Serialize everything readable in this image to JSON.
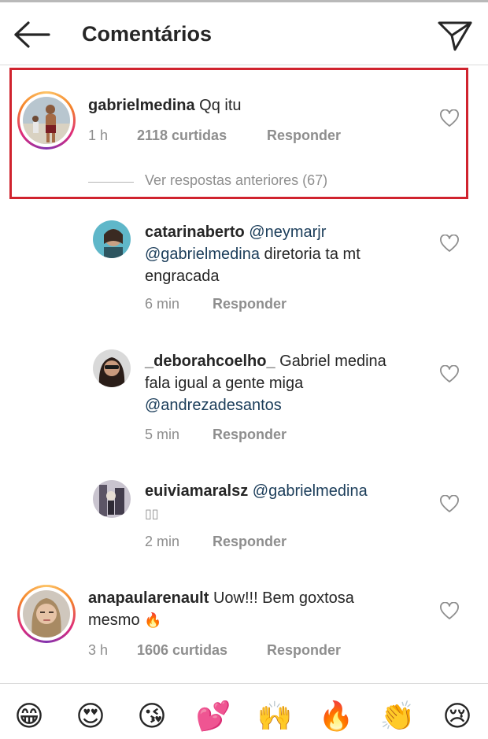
{
  "header": {
    "title": "Comentários",
    "back_icon": "arrow-left-icon",
    "send_icon": "paper-plane-icon"
  },
  "highlight_color": "#d0232e",
  "main_comment": {
    "username": "gabrielmedina",
    "text": "Qq itu",
    "time": "1 h",
    "likes": "2118 curtidas",
    "reply": "Responder",
    "view_previous": "Ver respostas anteriores (67)"
  },
  "replies": [
    {
      "username": "catarinaberto",
      "mention1": "@neymarjr",
      "mention2": "@gabrielmedina",
      "text_after": " diretoria ta mt",
      "line3": "engracada",
      "time": "6 min",
      "reply": "Responder"
    },
    {
      "username": "_deborahcoelho_",
      "text_line1": " Gabriel medina",
      "text_line2": "fala igual a gente miga",
      "mention": "@andrezadesantos",
      "time": "5 min",
      "reply": "Responder"
    },
    {
      "username": "euiviamaralsz",
      "mention": "@gabrielmedina",
      "text_line2": "▯▯",
      "time": "2 min",
      "reply": "Responder"
    }
  ],
  "second_comment": {
    "username": "anapaularenault",
    "text_line1": " Uow!!! Bem goxtosa",
    "text_line2": "mesmo",
    "fire": "🔥",
    "time": "3 h",
    "likes": "1606 curtidas",
    "reply": "Responder"
  },
  "emoji_bar": [
    "😁",
    "😍",
    "😘",
    "💕",
    "🙌",
    "🔥",
    "👏",
    "😢"
  ]
}
